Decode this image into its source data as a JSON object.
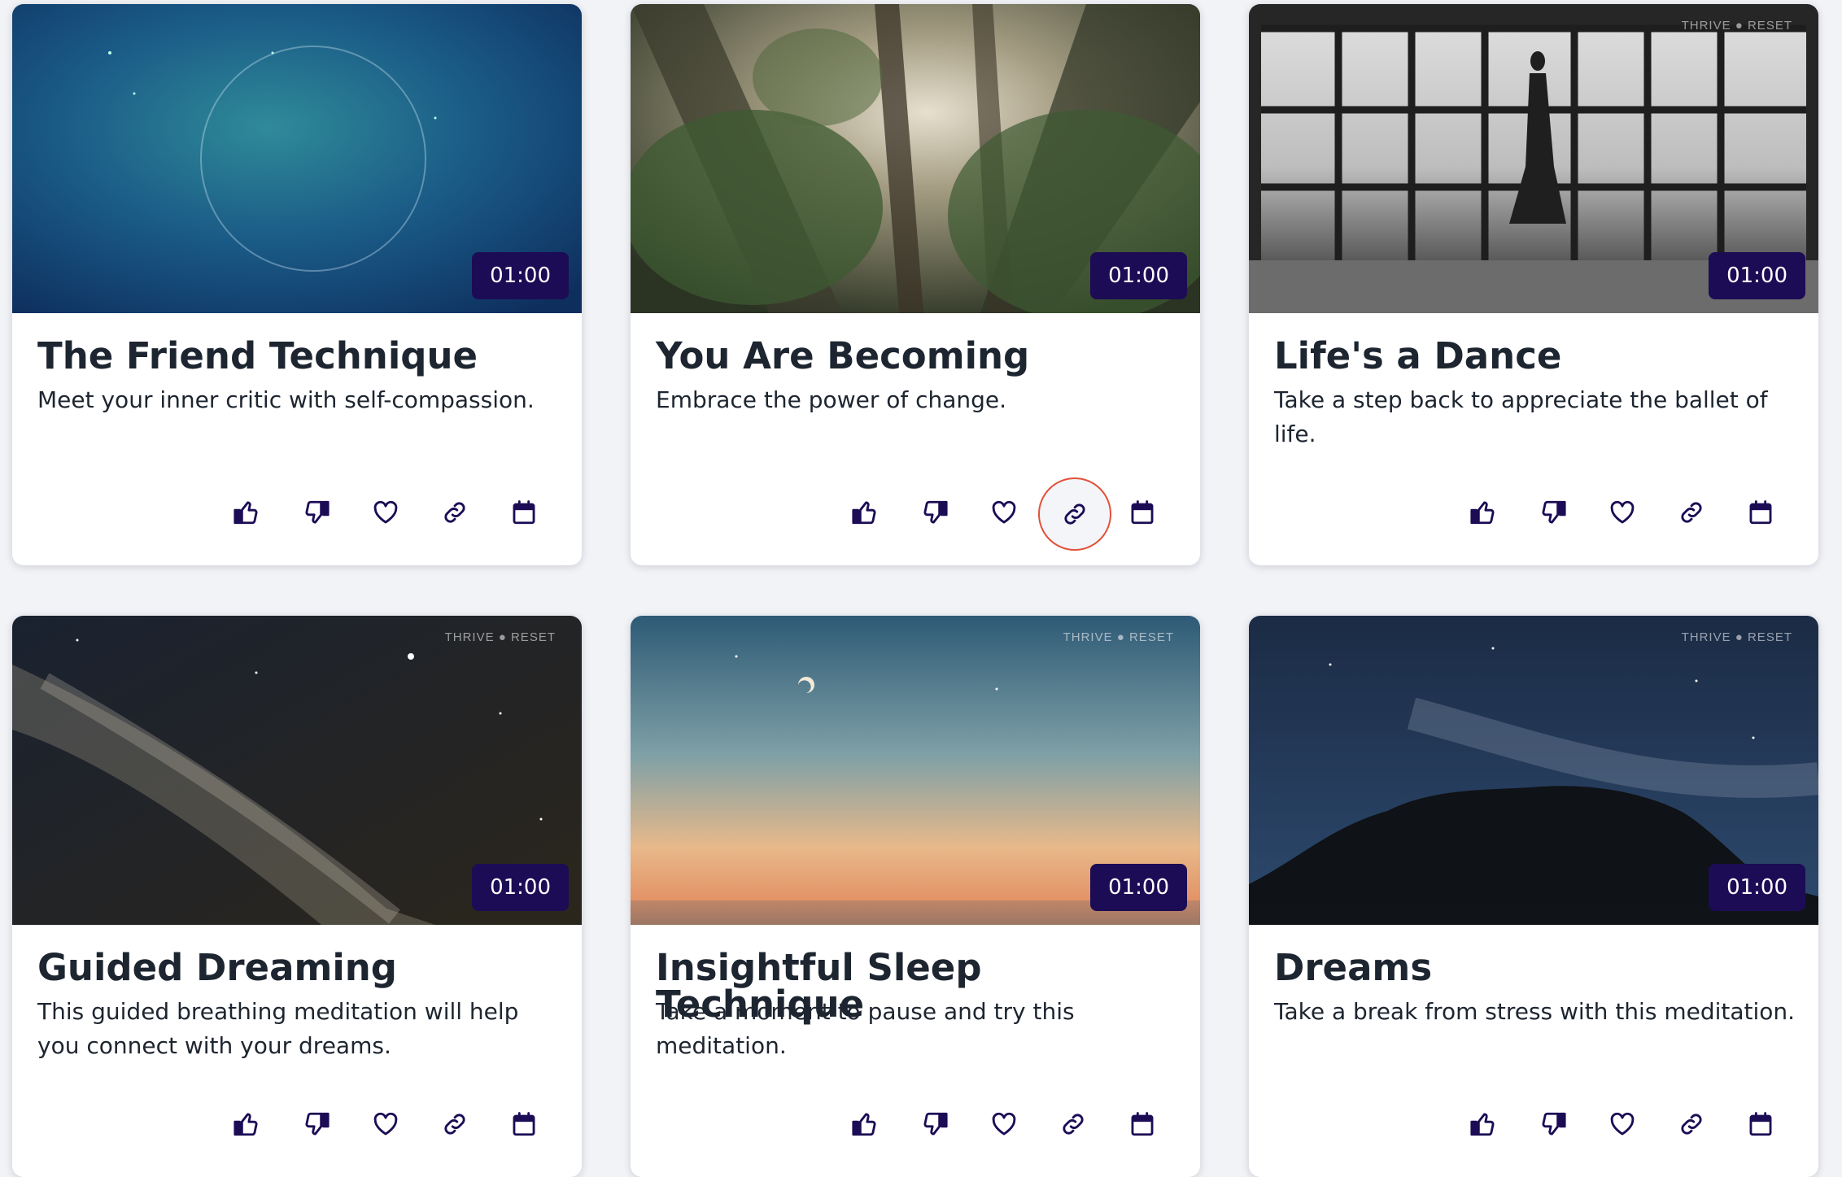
{
  "cards": [
    {
      "title": "The Friend Technique",
      "description": "Meet your inner critic with self-compassion.",
      "duration": "01:00",
      "watermark": ""
    },
    {
      "title": "You Are Becoming",
      "description": "Embrace the power of change.",
      "duration": "01:00",
      "watermark": ""
    },
    {
      "title": "Life's a Dance",
      "description": "Take a step back to appreciate the ballet of life.",
      "duration": "01:00",
      "watermark": "THRIVE ● RESET"
    },
    {
      "title": "Guided Dreaming",
      "description": "This guided breathing meditation will help you connect with your dreams.",
      "duration": "01:00",
      "watermark": "THRIVE ● RESET"
    },
    {
      "title": "Insightful Sleep Technique",
      "description": "Take a moment to pause and try this meditation.",
      "duration": "01:00",
      "watermark": "THRIVE ● RESET"
    },
    {
      "title": "Dreams",
      "description": "Take a break from stress with this meditation.",
      "duration": "01:00",
      "watermark": "THRIVE ● RESET"
    }
  ],
  "actions": [
    "thumbs-up-icon",
    "thumbs-down-icon",
    "heart-icon",
    "link-icon",
    "calendar-icon"
  ],
  "colors": {
    "accent": "#1c0c55",
    "icon": "#1c0c55",
    "highlight_ring": "#e2513a",
    "text": "#1d2530"
  }
}
